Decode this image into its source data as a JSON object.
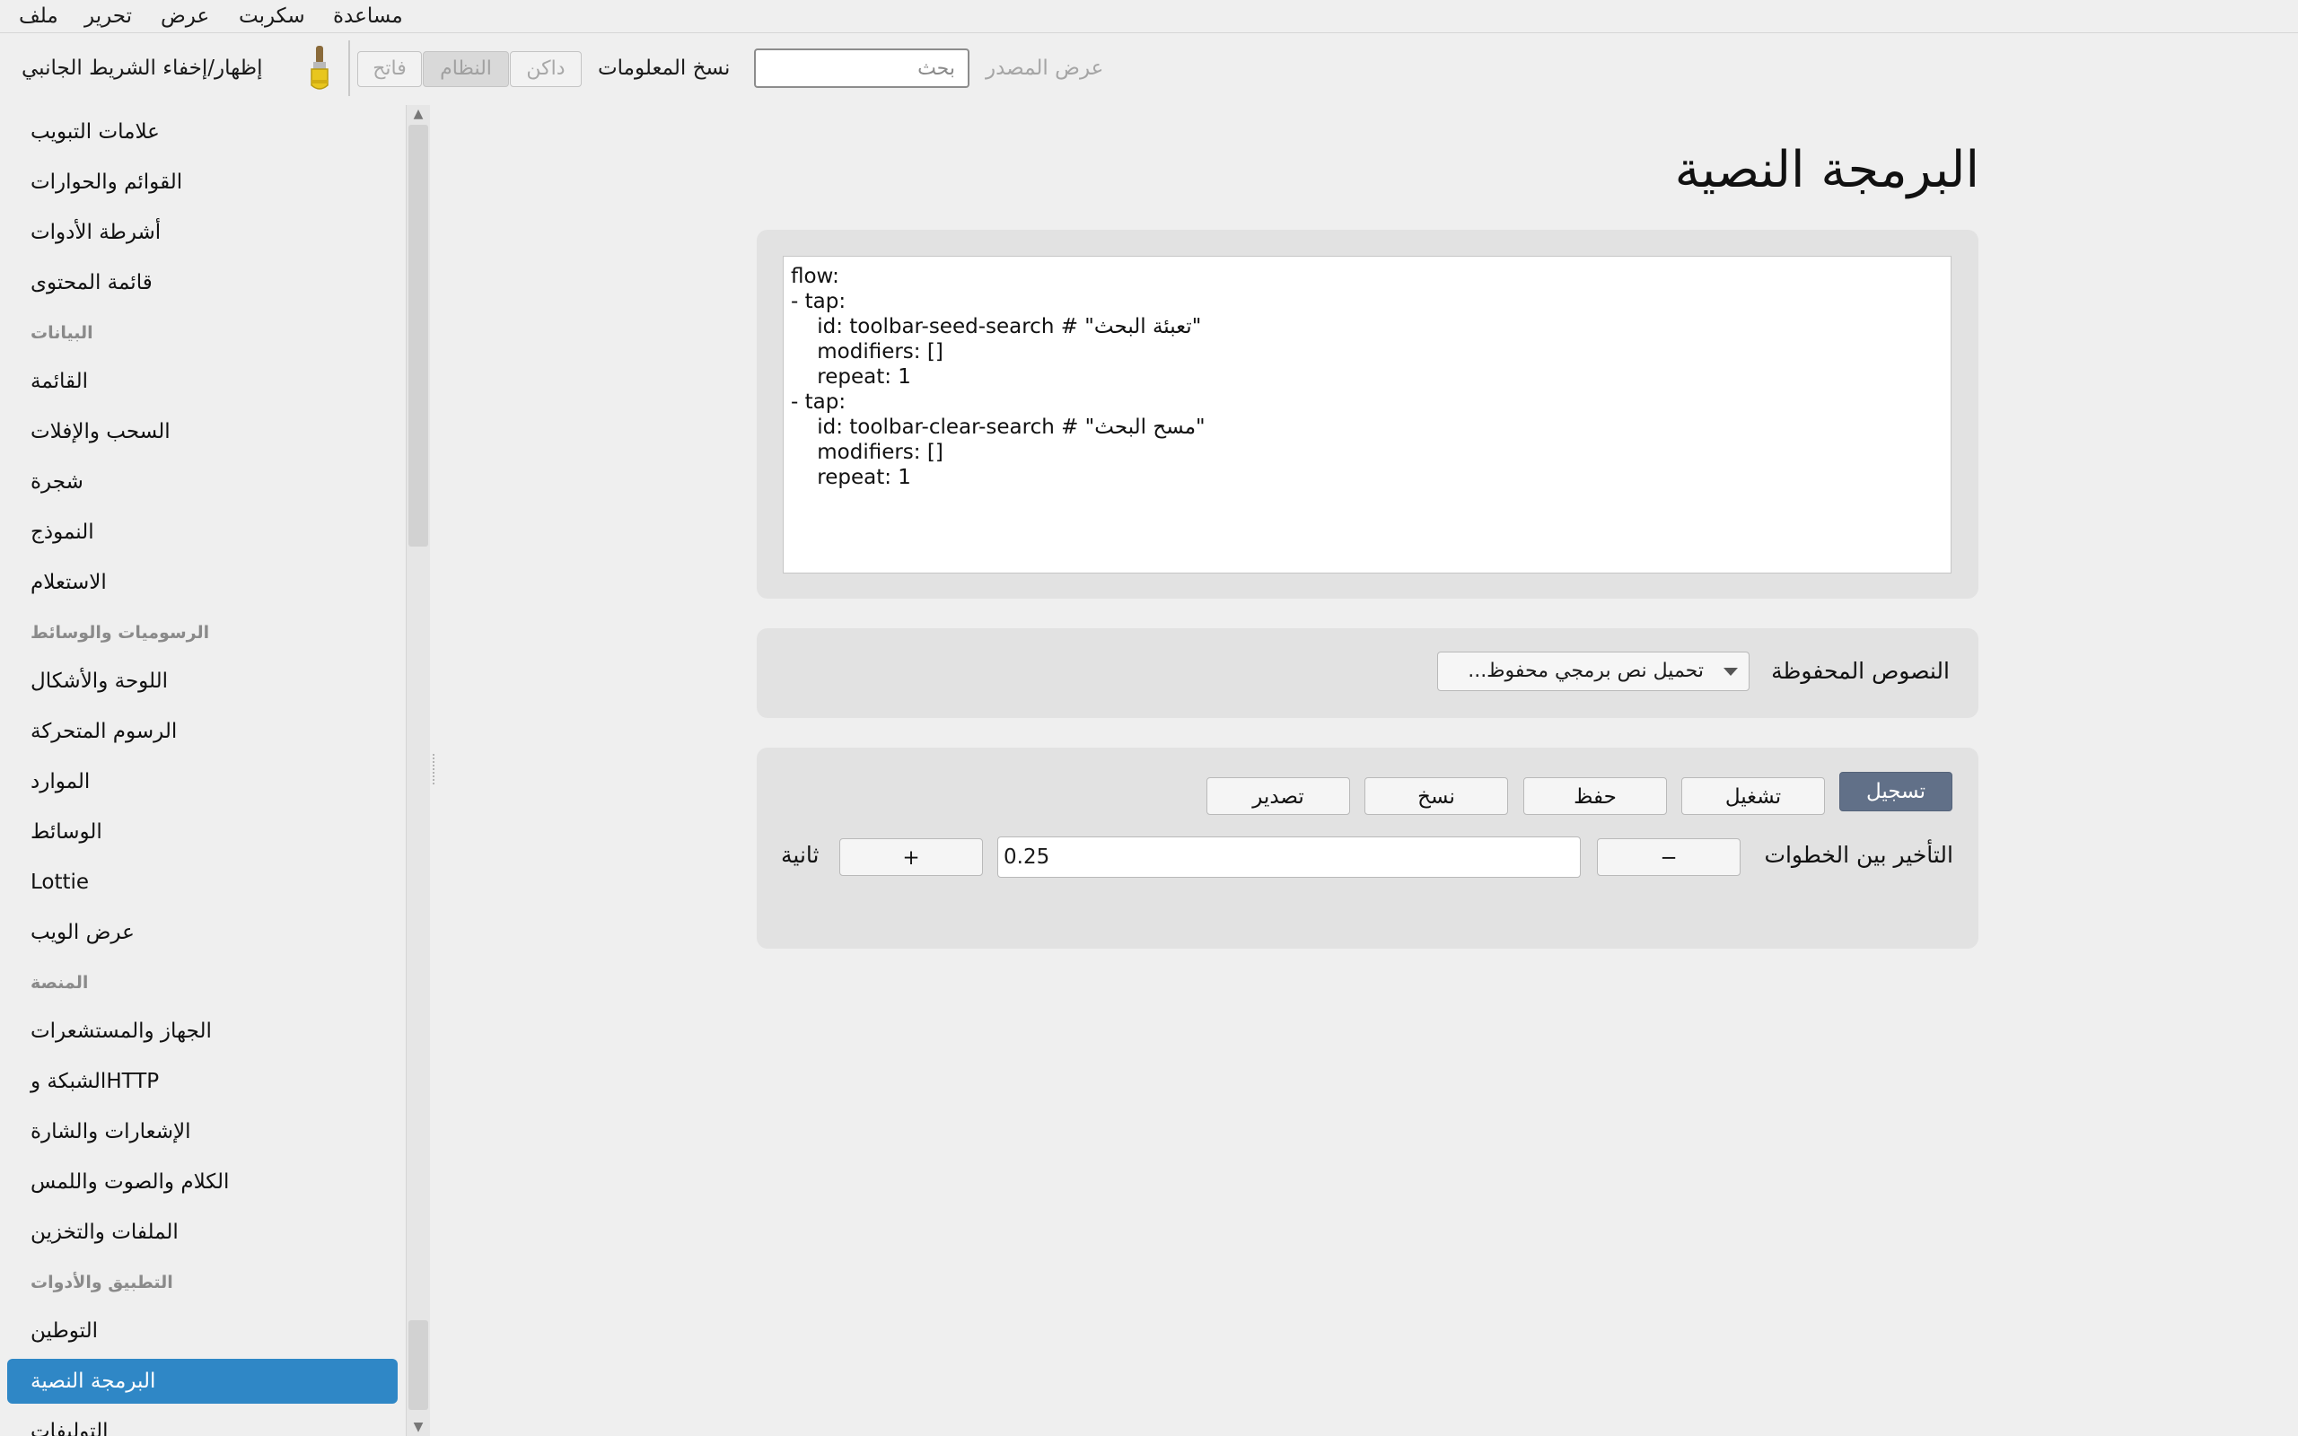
{
  "menu": {
    "file": "ملف",
    "edit": "تحرير",
    "view": "عرض",
    "script": "سكربت",
    "help": "مساعدة"
  },
  "toolbar": {
    "sidebar_toggle": "إظهار/إخفاء الشريط الجانبي",
    "brush_icon": "paintbrush-icon",
    "theme_light": "فاتح",
    "theme_system": "النظام",
    "theme_dark": "داكن",
    "copy_info": "نسخ المعلومات",
    "search_placeholder": "بحث",
    "view_source": "عرض المصدر"
  },
  "sidebar": {
    "items": [
      {
        "kind": "item",
        "label": "علامات التبويب"
      },
      {
        "kind": "item",
        "label": "القوائم والحوارات"
      },
      {
        "kind": "item",
        "label": "أشرطة الأدوات"
      },
      {
        "kind": "item",
        "label": "قائمة المحتوى"
      },
      {
        "kind": "header",
        "label": "البيانات"
      },
      {
        "kind": "item",
        "label": "القائمة"
      },
      {
        "kind": "item",
        "label": "السحب والإفلات"
      },
      {
        "kind": "item",
        "label": "شجرة"
      },
      {
        "kind": "item",
        "label": "النموذج"
      },
      {
        "kind": "item",
        "label": "الاستعلام"
      },
      {
        "kind": "header",
        "label": "الرسوميات والوسائط"
      },
      {
        "kind": "item",
        "label": "اللوحة والأشكال"
      },
      {
        "kind": "item",
        "label": "الرسوم المتحركة"
      },
      {
        "kind": "item",
        "label": "الموارد"
      },
      {
        "kind": "item",
        "label": "الوسائط"
      },
      {
        "kind": "item",
        "label": "Lottie"
      },
      {
        "kind": "item",
        "label": "عرض الويب"
      },
      {
        "kind": "header",
        "label": "المنصة"
      },
      {
        "kind": "item",
        "label": "الجهاز والمستشعرات"
      },
      {
        "kind": "item",
        "label": "الشبكة وHTTP"
      },
      {
        "kind": "item",
        "label": "الإشعارات والشارة"
      },
      {
        "kind": "item",
        "label": "الكلام والصوت واللمس"
      },
      {
        "kind": "item",
        "label": "الملفات والتخزين"
      },
      {
        "kind": "header",
        "label": "التطبيق والأدوات"
      },
      {
        "kind": "item",
        "label": "التوطين"
      },
      {
        "kind": "item",
        "label": "البرمجة النصية",
        "active": true
      },
      {
        "kind": "item",
        "label": "التوليفات"
      }
    ]
  },
  "main": {
    "title": "البرمجة النصية",
    "script_text": "flow:\n- tap:\n    id: toolbar-seed-search # \"تعبئة البحث\"\n    modifiers: []\n    repeat: 1\n- tap:\n    id: toolbar-clear-search # \"مسح البحث\"\n    modifiers: []\n    repeat: 1",
    "saved_scripts_label": "النصوص المحفوظة",
    "saved_scripts_dropdown": "تحميل نص برمجي محفوظ...",
    "buttons": {
      "record": "تسجيل",
      "run": "تشغيل",
      "save": "حفظ",
      "copy": "نسخ",
      "export": "تصدير"
    },
    "delay_label": "التأخير بين الخطوات",
    "delay_value": "0.25",
    "decrement": "−",
    "increment": "+",
    "unit": "ثانية"
  },
  "colors": {
    "accent": "#2f87c6",
    "primary_button": "#617088",
    "panel": "#e2e2e2",
    "background": "#efefef"
  }
}
